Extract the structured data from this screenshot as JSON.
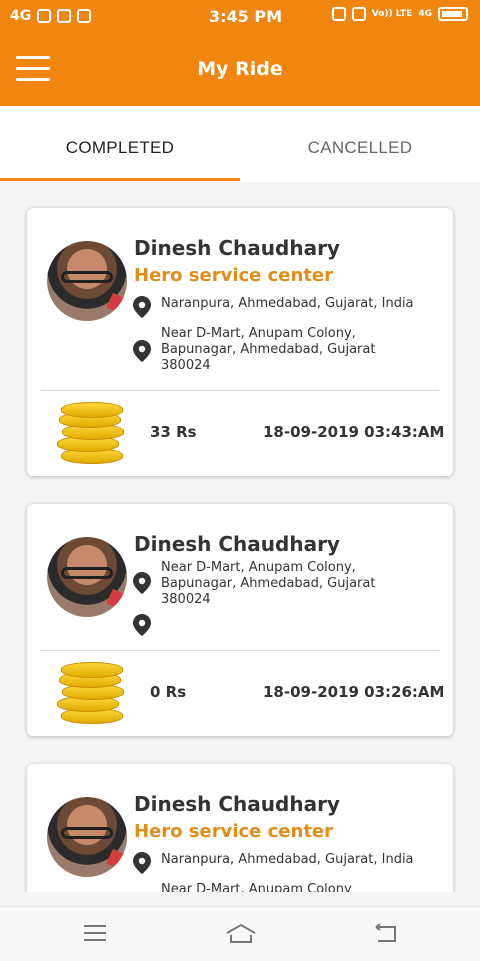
{
  "status_bar": {
    "network": "4G",
    "time": "3:45 PM",
    "right_label": "Vo)) LTE",
    "network_right": "4G"
  },
  "app_bar": {
    "title": "My Ride",
    "menu_icon": "hamburger-menu-icon"
  },
  "tabs": [
    {
      "label": "COMPLETED",
      "active": true
    },
    {
      "label": "CANCELLED",
      "active": false
    }
  ],
  "rides": [
    {
      "name": "Dinesh Chaudhary",
      "company": "Hero service center",
      "pickup": "Naranpura, Ahmedabad, Gujarat, India",
      "drop": "Near D-Mart, Anupam Colony, Bapunagar, Ahmedabad, Gujarat 380024",
      "amount": "33 Rs",
      "datetime": "18-09-2019 03:43:AM"
    },
    {
      "name": "Dinesh Chaudhary",
      "company": "",
      "pickup": "Near D-Mart, Anupam Colony, Bapunagar, Ahmedabad, Gujarat 380024",
      "drop": "",
      "amount": "0 Rs",
      "datetime": "18-09-2019 03:26:AM"
    },
    {
      "name": "Dinesh Chaudhary",
      "company": "Hero service center",
      "pickup": "Naranpura, Ahmedabad, Gujarat, India",
      "drop": "Near D-Mart, Anupam Colony"
    }
  ],
  "colors": {
    "primary": "#f0850f",
    "accent_text": "#e08e1a"
  },
  "nav_bar": {
    "icons": [
      "menu-icon",
      "home-icon",
      "back-icon"
    ]
  }
}
